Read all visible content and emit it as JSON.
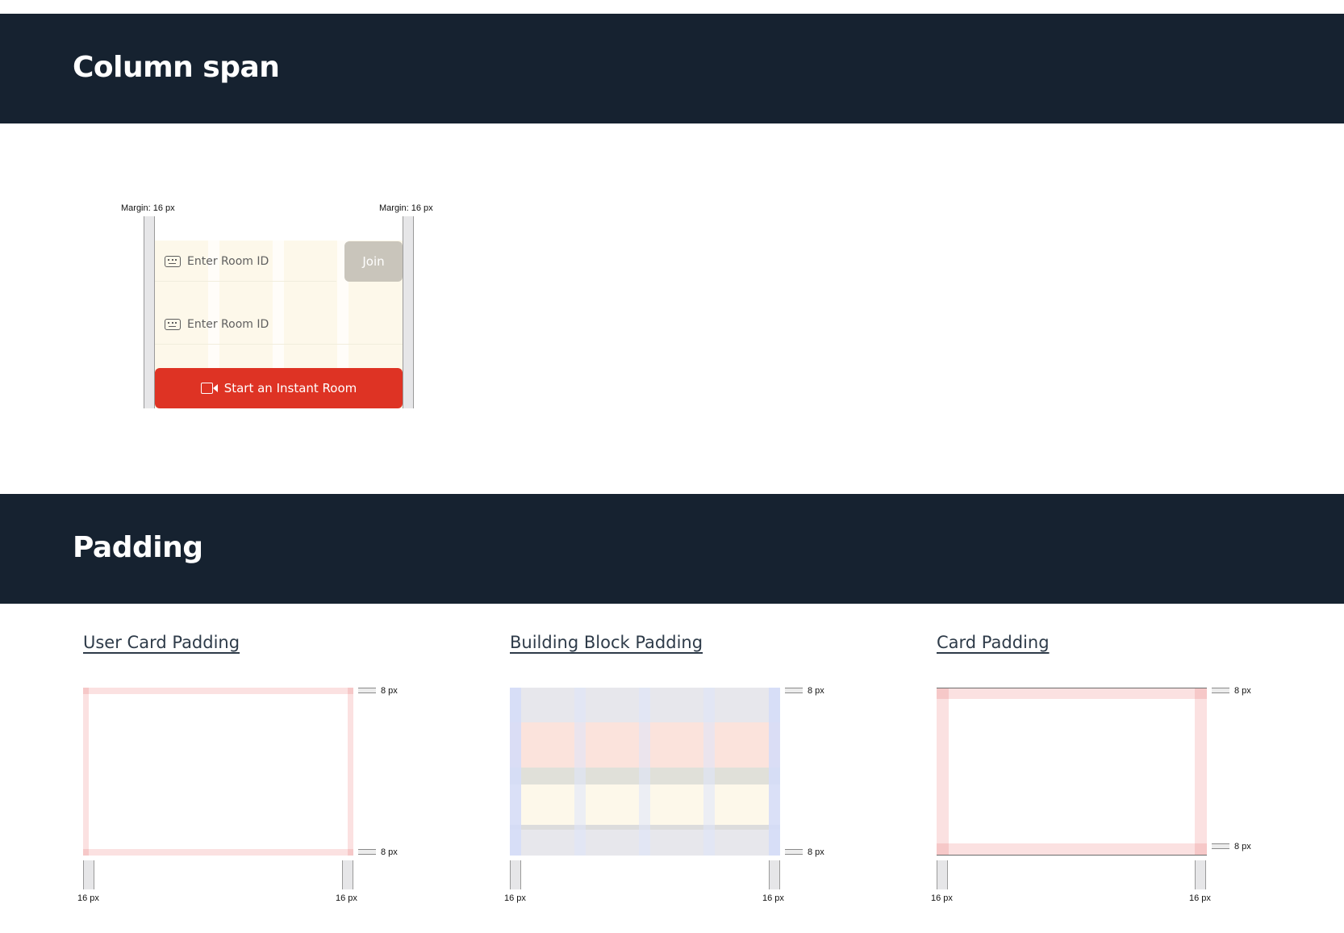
{
  "sections": {
    "column_span": {
      "title": "Column span"
    },
    "padding": {
      "title": "Padding"
    }
  },
  "column_span_demo": {
    "margin_left_label": "Margin: 16 px",
    "margin_right_label": "Margin: 16 px",
    "room_input_1_placeholder": "Enter Room ID",
    "room_input_2_placeholder": "Enter Room ID",
    "join_label": "Join",
    "instant_room_label": "Start an Instant Room",
    "colors": {
      "primary": "#de3324",
      "disabled": "#c9c5bb",
      "column_tint": "#fdf8ea"
    }
  },
  "padding_demos": [
    {
      "title": "User Card Padding",
      "top_label": "8 px",
      "bottom_label": "8 px",
      "left_label": "16 px",
      "right_label": "16 px"
    },
    {
      "title": "Building Block Padding",
      "top_label": "8 px",
      "bottom_label": "8 px",
      "left_label": "16 px",
      "right_label": "16 px"
    },
    {
      "title": "Card Padding",
      "top_label": "8 px",
      "bottom_label": "8 px",
      "left_label": "16 px",
      "right_label": "16 px"
    }
  ],
  "colors": {
    "header_band": "#162230",
    "padding_red": "#fbe1e1",
    "padding_blue": "#d4dcf9"
  }
}
